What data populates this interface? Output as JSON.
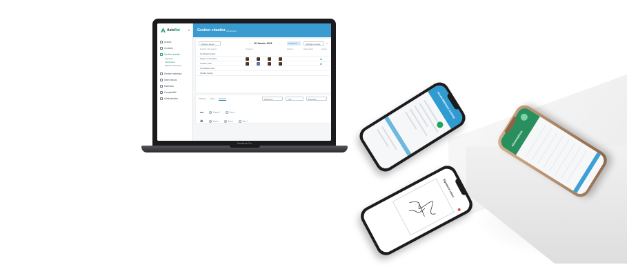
{
  "laptop": {
    "model_label": "MacBook Pro",
    "app": {
      "logo_prefix": "Axio",
      "logo_suffix": "Bat",
      "page_title": "Gestion chantier",
      "page_subtitle": "Planification",
      "nav": [
        {
          "label": "Accueil",
          "active": false
        },
        {
          "label": "Contacts",
          "active": false
        },
        {
          "label": "Gestion chantier",
          "active": true
        }
      ],
      "subnav": [
        {
          "label": "Chantiers",
          "active": false
        },
        {
          "label": "Planification",
          "active": true
        },
        {
          "label": "Bateaux effectuées",
          "active": false
        }
      ],
      "nav_bottom": [
        {
          "label": "Gestion matériaux"
        },
        {
          "label": "Interventions"
        },
        {
          "label": "Matériaux"
        },
        {
          "label": "Comptabilité"
        },
        {
          "label": "Administration"
        }
      ],
      "filter_select": "Chantiers actuels",
      "date": "20 Janvier 2021",
      "today_button": "Aujourd'hui",
      "view_select": "Affichage semaine",
      "columns": [
        "Chantier / Site Gestion",
        "Personnel",
        "Véhicule",
        "Observations",
        "Actions"
      ],
      "rows": [
        "Coordination projets",
        "Travaux et rénovation",
        "Livraison poste",
        "Coordination sortie",
        "Chantier Gestion"
      ],
      "tabs": [
        "Chantier",
        "Vous",
        "Véhicule"
      ],
      "active_tab": "Véhicule",
      "search_placeholder": "Recherche",
      "type_select": "Type",
      "group_select": "Ensemble",
      "chips_row1": [
        "Grappe A",
        "Fourmi"
      ],
      "chips_row2": [
        "Camion",
        "Alarme",
        "Labo 1"
      ]
    }
  },
  "phones": {
    "left": {
      "title": "Accès Bâtiment Axiobat"
    },
    "right": {
      "title": "Alimentations"
    },
    "bottom": {
      "title": "Signature client"
    }
  },
  "colors": {
    "brand_green": "#1fa463",
    "header_blue": "#3a9bd0",
    "laptop_body": "#1b1b1d",
    "phone_body": "#1c1c1e",
    "phone_gold": "#d9b08c"
  }
}
